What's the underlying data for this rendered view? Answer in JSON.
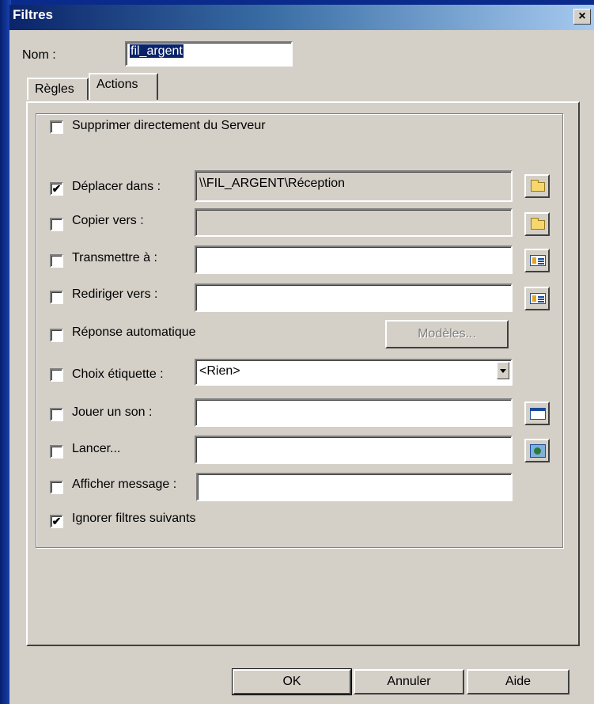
{
  "window": {
    "title": "Filtres",
    "close_label": "×"
  },
  "name_field": {
    "label": "Nom :",
    "value": "fil_argent"
  },
  "tabs": [
    {
      "label": "Règles"
    },
    {
      "label": "Actions"
    }
  ],
  "actions": {
    "delete_server": {
      "label": "Supprimer directement du Serveur",
      "checked": false
    },
    "move_to": {
      "label": "Déplacer dans :",
      "checked": true,
      "value": "\\\\FIL_ARGENT\\Réception",
      "icon": "folder-icon"
    },
    "copy_to": {
      "label": "Copier vers :",
      "checked": false,
      "value": "",
      "icon": "folder-icon"
    },
    "forward_to": {
      "label": "Transmettre à :",
      "checked": false,
      "value": "",
      "icon": "address-book-icon"
    },
    "redirect_to": {
      "label": "Rediriger vers :",
      "checked": false,
      "value": "",
      "icon": "address-book-icon"
    },
    "auto_reply": {
      "label": "Réponse automatique",
      "checked": false,
      "button": "Modèles..."
    },
    "label_choice": {
      "label": "Choix étiquette :",
      "checked": false,
      "value": "<Rien>"
    },
    "play_sound": {
      "label": "Jouer un son :",
      "checked": false,
      "value": "",
      "icon": "window-icon"
    },
    "launch": {
      "label": "Lancer...",
      "checked": false,
      "value": "",
      "icon": "run-icon"
    },
    "show_message": {
      "label": "Afficher message :",
      "checked": false,
      "value": ""
    },
    "ignore_next": {
      "label": "Ignorer filtres suivants",
      "checked": true
    }
  },
  "buttons": {
    "ok": "OK",
    "cancel": "Annuler",
    "help": "Aide"
  },
  "check_mark": "✔"
}
